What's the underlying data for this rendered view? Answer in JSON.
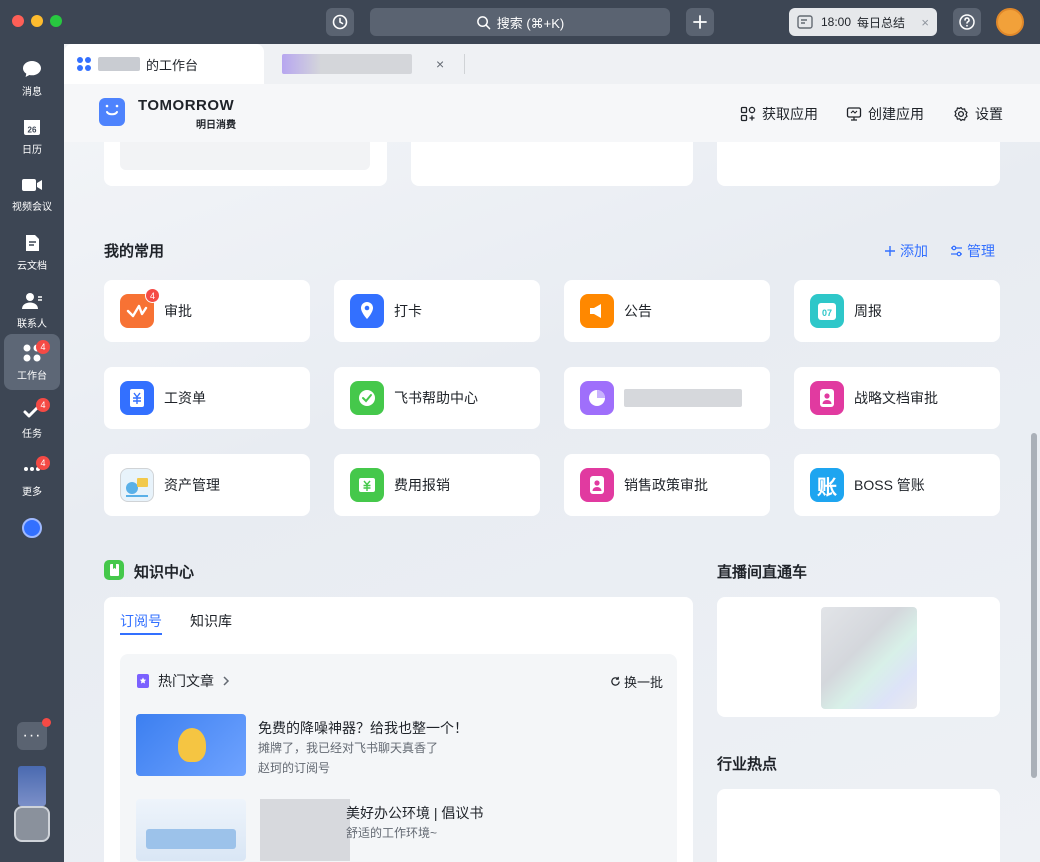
{
  "titlebar": {
    "search_label": "搜索 (⌘+K)",
    "summary_time": "18:00",
    "summary_label": "每日总结"
  },
  "leftnav": {
    "items": [
      {
        "label": "消息",
        "icon": "chat-icon"
      },
      {
        "label": "日历",
        "icon": "calendar-icon",
        "date": "26"
      },
      {
        "label": "视频会议",
        "icon": "video-icon"
      },
      {
        "label": "云文档",
        "icon": "doc-icon"
      },
      {
        "label": "联系人",
        "icon": "contacts-icon"
      },
      {
        "label": "工作台",
        "icon": "workplace-icon",
        "badge": "4"
      },
      {
        "label": "任务",
        "icon": "task-icon",
        "badge": "4"
      },
      {
        "label": "更多",
        "icon": "more-icon",
        "badge": "4"
      }
    ]
  },
  "tabs": {
    "tab1_suffix": "的工作台",
    "close": "×"
  },
  "header": {
    "brand": "TOMORROW",
    "brand_sub": "明日消费",
    "get_apps": "获取应用",
    "create_app": "创建应用",
    "settings": "设置"
  },
  "favorites": {
    "title": "我的常用",
    "add": "添加",
    "manage": "管理",
    "apps": [
      {
        "label": "审批",
        "badge": "4",
        "color": "#f77234"
      },
      {
        "label": "打卡",
        "color": "#3370ff"
      },
      {
        "label": "公告",
        "color": "#ff8800"
      },
      {
        "label": "周报",
        "color": "#2ec7c9",
        "date": "07"
      },
      {
        "label": "工资单",
        "color": "#3370ff"
      },
      {
        "label": "飞书帮助中心",
        "color": "#45c84b"
      },
      {
        "label": "",
        "color": "#9f6ffb"
      },
      {
        "label": "战略文档审批",
        "color": "#e13aa0"
      },
      {
        "label": "资产管理",
        "color": "#5ab0e8"
      },
      {
        "label": "费用报销",
        "color": "#45c84b"
      },
      {
        "label": "销售政策审批",
        "color": "#e13aa0"
      },
      {
        "label": "BOSS 管账",
        "color": "#1ea5f0",
        "glyph": "账"
      }
    ]
  },
  "knowledge": {
    "title": "知识中心",
    "tab_subscriptions": "订阅号",
    "tab_library": "知识库",
    "hot_articles": "热门文章",
    "refresh": "换一批",
    "articles": [
      {
        "title": "免费的降噪神器？给我也整一个！",
        "subtitle": "摊牌了，我已经对飞书聊天真香了",
        "source": "赵珂的订阅号"
      },
      {
        "title": "美好办公环境 | 倡议书",
        "subtitle": "舒适的工作环境~",
        "source": ""
      }
    ]
  },
  "live": {
    "title": "直播间直通车"
  },
  "industry": {
    "title": "行业热点"
  }
}
